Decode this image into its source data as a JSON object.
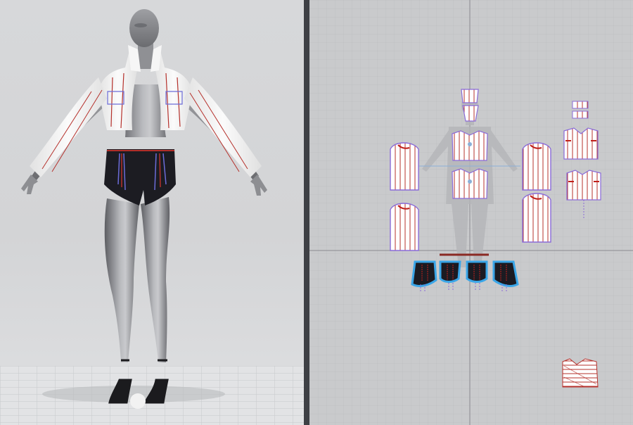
{
  "app": {
    "panes": [
      "3d-viewport",
      "2d-pattern-window"
    ]
  },
  "viewport_3d": {
    "avatar": "female-avatar",
    "garments": [
      "cropped-striped-jacket",
      "striped-shorts"
    ],
    "shoes": "black-strappy-heels",
    "colors": {
      "background": "#d6d7d9",
      "fabric_white": "#f4f4f4",
      "stripe": "#a0302b",
      "shorts": "#1c1c22",
      "topstitch": "#6c6cd8"
    }
  },
  "pattern_window": {
    "colors": {
      "grid_bg": "#c9cacc",
      "grid_line": "#bcbdc0",
      "axis": "#8a8b90",
      "piece_fill": "#ffffff",
      "stripe": "#b5302b",
      "seam": "#8a6bd8",
      "shorts_fill": "#1b1b22",
      "shorts_outline": "#3aa6e8"
    },
    "pieces": [
      "collar",
      "front-yoke",
      "back-panel-upper",
      "back-panel-lower",
      "sleeve-left-upper",
      "sleeve-left-lower",
      "sleeve-right-upper",
      "sleeve-right-lower",
      "cuff-top",
      "cuff-bottom",
      "front-bodice",
      "back-bodice",
      "waistband",
      "shorts-front-left",
      "shorts-front-right",
      "shorts-back-left",
      "shorts-back-right",
      "fabric-swatch"
    ]
  }
}
